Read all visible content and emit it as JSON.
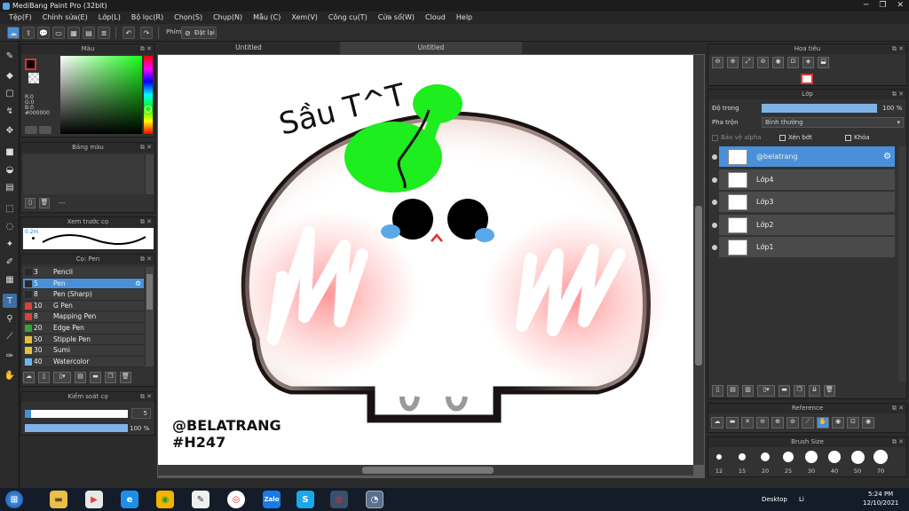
{
  "window": {
    "title": "MediBang Paint Pro (32bit)"
  },
  "menu": [
    "Tệp(F)",
    "Chỉnh sửa(E)",
    "Lớp(L)",
    "Bộ lọc(R)",
    "Chọn(S)",
    "Chụp(N)",
    "Mẫu (C)",
    "Xem(V)",
    "Công cụ(T)",
    "Cửa sổ(W)",
    "Cloud",
    "Help"
  ],
  "toolbar": {
    "keys_label": "Phím",
    "reset_label": "Đặt lại"
  },
  "tabs": [
    "Untitled",
    "Untitled"
  ],
  "color_panel": {
    "title": "Màu",
    "r": "R:0",
    "g": "G:0",
    "b": "B:0",
    "hex": "#000000"
  },
  "palette_panel": {
    "title": "Bảng màu",
    "empty": "---"
  },
  "brush_preview": {
    "title": "Xem trước cọ",
    "size": "0.2m"
  },
  "brush_panel": {
    "title": "Cọ: Pen",
    "items": [
      {
        "size": "3",
        "name": "Pencil",
        "color": "#2a2a2a"
      },
      {
        "size": "5",
        "name": "Pen",
        "color": "#2a2a2a"
      },
      {
        "size": "8",
        "name": "Pen (Sharp)",
        "color": "#2a2a2a"
      },
      {
        "size": "10",
        "name": "G Pen",
        "color": "#d9413a"
      },
      {
        "size": "8",
        "name": "Mapping Pen",
        "color": "#d9413a"
      },
      {
        "size": "20",
        "name": "Edge Pen",
        "color": "#3aa13a"
      },
      {
        "size": "50",
        "name": "Stipple Pen",
        "color": "#e0c23a"
      },
      {
        "size": "30",
        "name": "Sumi",
        "color": "#e0c23a"
      },
      {
        "size": "40",
        "name": "Watercolor",
        "color": "#6ab8e8"
      }
    ]
  },
  "control_panel": {
    "title": "Kiểm soát cọ",
    "size_value": "5",
    "opacity_value": "100 %",
    "opacity_level": 1.0,
    "size_level": 0.06
  },
  "navigator": {
    "title": "Hoa tiêu"
  },
  "layer_panel": {
    "title": "Lớp",
    "opacity_label": "Độ trong",
    "opacity_value": "100 %",
    "opacity_level": 1.0,
    "blend_label": "Pha trộn",
    "blend_value": "Bình thường",
    "protect_alpha": "Bảo vệ alpha",
    "clipping": "Xén bớt",
    "lock": "Khóa",
    "layers": [
      {
        "name": "@belatrang",
        "selected": true
      },
      {
        "name": "Lớp4",
        "selected": false
      },
      {
        "name": "Lớp3",
        "selected": false
      },
      {
        "name": "Lớp2",
        "selected": false
      },
      {
        "name": "Lớp1",
        "selected": false
      }
    ]
  },
  "reference_panel": {
    "title": "Reference"
  },
  "brush_size_panel": {
    "title": "Brush Size",
    "sizes": [
      "12",
      "15",
      "20",
      "25",
      "30",
      "40",
      "50",
      "70"
    ]
  },
  "artwork": {
    "caption": "Sầu T^T",
    "watermark_line1": "@BELATRANG",
    "watermark_line2": "#H247"
  },
  "taskbar": {
    "desktop_label": "Desktop",
    "lang": "Li",
    "time": "5:24 PM",
    "date": "12/10/2021"
  }
}
